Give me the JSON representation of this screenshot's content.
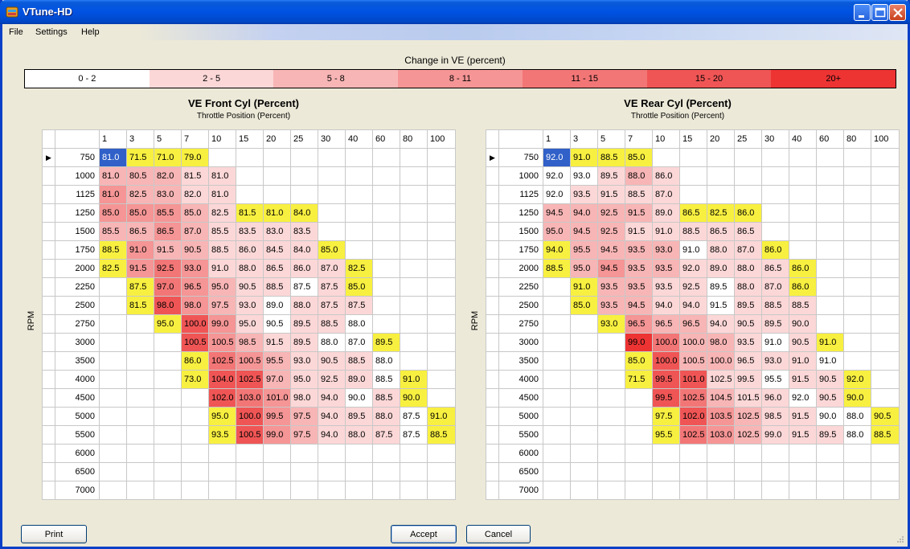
{
  "window": {
    "title": "VTune-HD"
  },
  "menu": [
    "File",
    "Settings",
    "Help"
  ],
  "scale": {
    "caption": "Change in VE (percent)",
    "segments": [
      {
        "label": "0 - 2",
        "color": "#ffffff"
      },
      {
        "label": "2 - 5",
        "color": "#fcd7d7"
      },
      {
        "label": "5 - 8",
        "color": "#f8b5b5"
      },
      {
        "label": "8 - 11",
        "color": "#f59595"
      },
      {
        "label": "11 - 15",
        "color": "#f37676"
      },
      {
        "label": "15 - 20",
        "color": "#f05555"
      },
      {
        "label": "20+",
        "color": "#ee3333"
      }
    ]
  },
  "colors": {
    "yellow": "#f8f040",
    "blue": "#3060c8"
  },
  "columns": [
    "1",
    "3",
    "5",
    "7",
    "10",
    "15",
    "20",
    "25",
    "30",
    "40",
    "60",
    "80",
    "100"
  ],
  "rows": [
    "750",
    "1000",
    "1125",
    "1250",
    "1500",
    "1750",
    "2000",
    "2250",
    "2500",
    "2750",
    "3000",
    "3500",
    "4000",
    "4500",
    "5000",
    "5500",
    "6000",
    "6500",
    "7000"
  ],
  "front": {
    "title": "VE Front Cyl (Percent)",
    "subtitle": "Throttle Position (Percent)",
    "axis": "RPM",
    "cells": [
      [
        "81.0:b",
        "71.5:y",
        "71.0:y",
        "79.0:y",
        "",
        "",
        "",
        "",
        "",
        "",
        "",
        "",
        ""
      ],
      [
        "81.0:2",
        "80.5:2",
        "82.0:2",
        "81.5:1",
        "81.0:1",
        "",
        "",
        "",
        "",
        "",
        "",
        "",
        ""
      ],
      [
        "81.0:3",
        "82.5:2",
        "83.0:2",
        "82.0:1",
        "81.0:1",
        "",
        "",
        "",
        "",
        "",
        "",
        "",
        ""
      ],
      [
        "85.0:3",
        "85.0:3",
        "85.5:3",
        "85.0:2",
        "82.5:1",
        "81.5:y",
        "81.0:y",
        "84.0:y",
        "",
        "",
        "",
        "",
        ""
      ],
      [
        "85.5:2",
        "86.5:2",
        "86.5:3",
        "87.0:2",
        "85.5:1",
        "83.5:1",
        "83.0:1",
        "83.5:1",
        "",
        "",
        "",
        "",
        ""
      ],
      [
        "88.5:y",
        "91.0:3",
        "91.5:2",
        "90.5:2",
        "88.5:1",
        "86.0:1",
        "84.5:1",
        "84.0:1",
        "85.0:y",
        "",
        "",
        "",
        ""
      ],
      [
        "82.5:y",
        "91.5:3",
        "92.5:4",
        "93.0:3",
        "91.0:1",
        "88.0:1",
        "86.5:1",
        "86.0:1",
        "87.0:1",
        "82.5:y",
        "",
        "",
        ""
      ],
      [
        "",
        "87.5:y",
        "97.0:4",
        "96.5:3",
        "95.0:2",
        "90.5:1",
        "88.5:1",
        "87.5:0",
        "87.5:1",
        "85.0:y",
        "",
        "",
        ""
      ],
      [
        "",
        "81.5:y",
        "98.0:5",
        "98.0:3",
        "97.5:2",
        "93.0:1",
        "89.0:0",
        "88.0:1",
        "87.5:1",
        "87.5:1",
        "",
        "",
        ""
      ],
      [
        "",
        "",
        "95.0:y",
        "100.0:5",
        "99.0:3",
        "95.0:1",
        "90.5:0",
        "89.5:1",
        "88.5:1",
        "88.0:0",
        "",
        "",
        ""
      ],
      [
        "",
        "",
        "",
        "100.5:5",
        "100.5:3",
        "98.5:2",
        "91.5:1",
        "89.5:1",
        "88.0:0",
        "87.0:0",
        "89.5:y",
        "",
        ""
      ],
      [
        "",
        "",
        "",
        "86.0:y",
        "102.5:4",
        "100.5:3",
        "95.5:2",
        "93.0:1",
        "90.5:1",
        "88.5:1",
        "88.0:0",
        "",
        ""
      ],
      [
        "",
        "",
        "",
        "73.0:y",
        "104.0:5",
        "102.5:5",
        "97.0:2",
        "95.0:1",
        "92.5:1",
        "89.0:1",
        "88.5:0",
        "91.0:y",
        ""
      ],
      [
        "",
        "",
        "",
        "",
        "102.0:5",
        "103.0:4",
        "101.0:3",
        "98.0:1",
        "94.0:1",
        "90.0:0",
        "88.5:1",
        "90.0:y",
        ""
      ],
      [
        "",
        "",
        "",
        "",
        "95.0:y",
        "100.0:5",
        "99.5:3",
        "97.5:2",
        "94.0:1",
        "89.5:1",
        "88.0:1",
        "87.5:0",
        "91.0:y"
      ],
      [
        "",
        "",
        "",
        "",
        "93.5:y",
        "100.5:5",
        "99.0:3",
        "97.5:2",
        "94.0:1",
        "88.0:1",
        "87.5:1",
        "87.5:0",
        "88.5:y"
      ],
      [
        "",
        "",
        "",
        "",
        "",
        "",
        "",
        "",
        "",
        "",
        "",
        "",
        ""
      ],
      [
        "",
        "",
        "",
        "",
        "",
        "",
        "",
        "",
        "",
        "",
        "",
        "",
        ""
      ],
      [
        "",
        "",
        "",
        "",
        "",
        "",
        "",
        "",
        "",
        "",
        "",
        "",
        ""
      ]
    ]
  },
  "rear": {
    "title": "VE Rear Cyl (Percent)",
    "subtitle": "Throttle Position (Percent)",
    "axis": "RPM",
    "cells": [
      [
        "92.0:b",
        "91.0:y",
        "88.5:y",
        "85.0:y",
        "",
        "",
        "",
        "",
        "",
        "",
        "",
        "",
        ""
      ],
      [
        "92.0:0",
        "93.0:0",
        "89.5:1",
        "88.0:2",
        "86.0:1",
        "",
        "",
        "",
        "",
        "",
        "",
        "",
        ""
      ],
      [
        "92.0:0",
        "93.5:1",
        "91.5:1",
        "88.5:1",
        "87.0:1",
        "",
        "",
        "",
        "",
        "",
        "",
        "",
        ""
      ],
      [
        "94.5:2",
        "94.0:2",
        "92.5:2",
        "91.5:2",
        "89.0:1",
        "86.5:y",
        "82.5:y",
        "86.0:y",
        "",
        "",
        "",
        "",
        ""
      ],
      [
        "95.0:2",
        "94.5:2",
        "92.5:2",
        "91.5:1",
        "91.0:1",
        "88.5:1",
        "86.5:1",
        "86.5:1",
        "",
        "",
        "",
        "",
        ""
      ],
      [
        "94.0:y",
        "95.5:2",
        "94.5:2",
        "93.5:2",
        "93.0:2",
        "91.0:0",
        "88.0:1",
        "87.0:1",
        "86.0:y",
        "",
        "",
        "",
        ""
      ],
      [
        "88.5:y",
        "95.0:2",
        "94.5:3",
        "93.5:2",
        "93.5:2",
        "92.0:1",
        "89.0:1",
        "88.0:1",
        "86.5:1",
        "86.0:y",
        "",
        "",
        ""
      ],
      [
        "",
        "91.0:y",
        "93.5:2",
        "93.5:2",
        "93.5:1",
        "92.5:1",
        "89.5:0",
        "88.0:1",
        "87.0:1",
        "86.0:y",
        "",
        "",
        ""
      ],
      [
        "",
        "85.0:y",
        "93.5:2",
        "94.5:2",
        "94.0:1",
        "94.0:1",
        "91.5:0",
        "89.5:1",
        "88.5:1",
        "88.5:1",
        "",
        "",
        ""
      ],
      [
        "",
        "",
        "93.0:y",
        "96.5:3",
        "96.5:2",
        "96.5:2",
        "94.0:1",
        "90.5:1",
        "89.5:1",
        "90.0:1",
        "",
        "",
        ""
      ],
      [
        "",
        "",
        "",
        "99.0:6",
        "100.0:4",
        "100.0:2",
        "98.0:2",
        "93.5:1",
        "91.0:0",
        "90.5:1",
        "91.0:y",
        "",
        ""
      ],
      [
        "",
        "",
        "",
        "85.0:y",
        "100.0:5",
        "100.5:2",
        "100.0:2",
        "96.5:1",
        "93.0:1",
        "91.0:1",
        "91.0:0",
        "",
        ""
      ],
      [
        "",
        "",
        "",
        "71.5:y",
        "99.5:5",
        "101.0:5",
        "102.5:1",
        "99.5:1",
        "95.5:0",
        "91.5:1",
        "90.5:1",
        "92.0:y",
        ""
      ],
      [
        "",
        "",
        "",
        "",
        "99.5:5",
        "102.5:4",
        "104.5:2",
        "101.5:1",
        "96.0:1",
        "92.0:0",
        "90.5:1",
        "90.0:y",
        ""
      ],
      [
        "",
        "",
        "",
        "",
        "97.5:y",
        "102.0:5",
        "103.5:3",
        "102.5:2",
        "98.5:1",
        "91.5:1",
        "90.0:0",
        "88.0:0",
        "90.5:y"
      ],
      [
        "",
        "",
        "",
        "",
        "95.5:y",
        "102.5:4",
        "103.0:3",
        "102.5:2",
        "99.0:1",
        "91.5:1",
        "89.5:1",
        "88.0:0",
        "88.5:y"
      ],
      [
        "",
        "",
        "",
        "",
        "",
        "",
        "",
        "",
        "",
        "",
        "",
        "",
        ""
      ],
      [
        "",
        "",
        "",
        "",
        "",
        "",
        "",
        "",
        "",
        "",
        "",
        "",
        ""
      ],
      [
        "",
        "",
        "",
        "",
        "",
        "",
        "",
        "",
        "",
        "",
        "",
        "",
        ""
      ]
    ]
  },
  "buttons": {
    "print": "Print",
    "accept": "Accept",
    "cancel": "Cancel"
  }
}
